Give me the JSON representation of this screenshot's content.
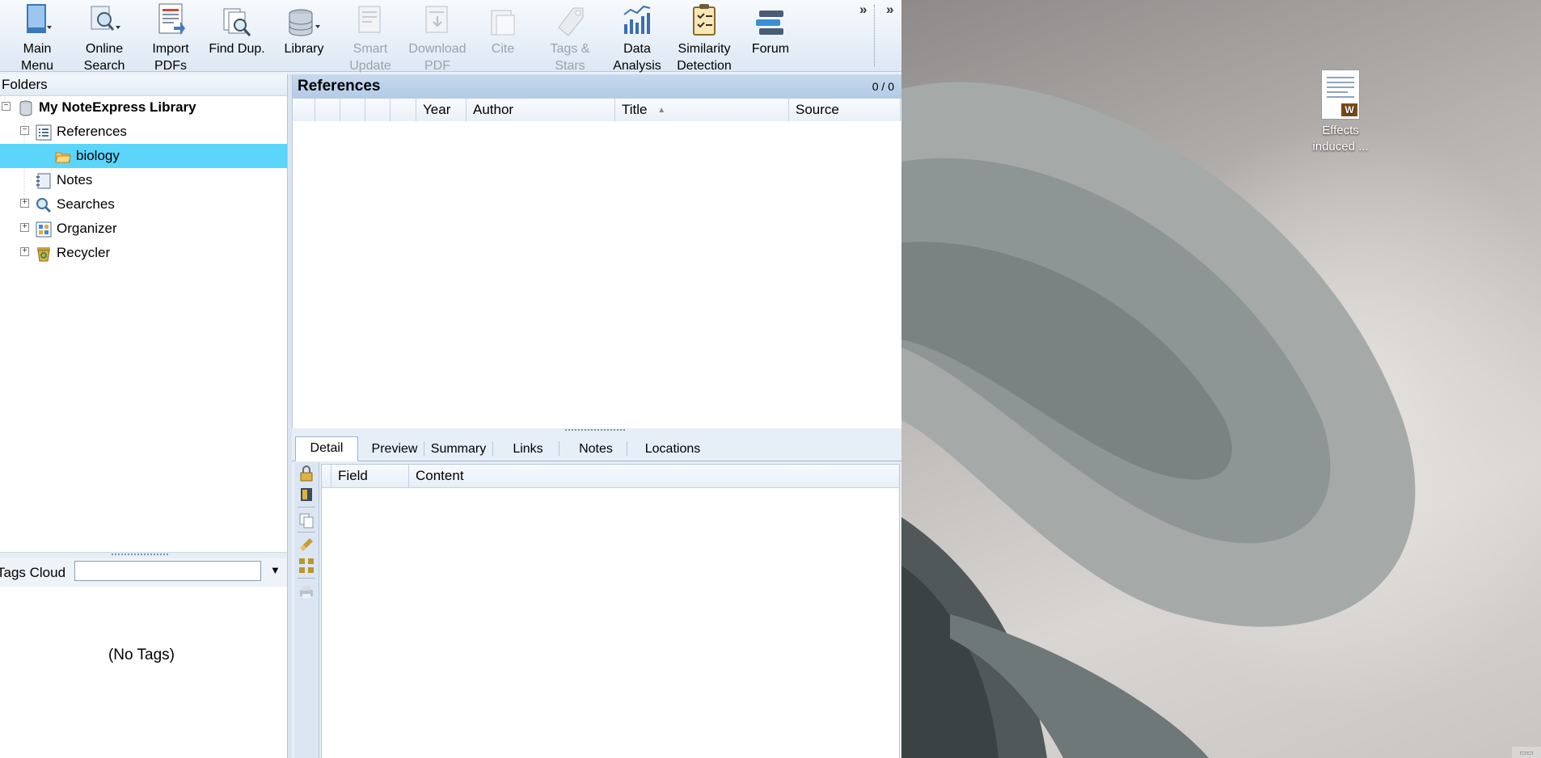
{
  "toolbar": {
    "items": [
      {
        "label_1": "Main",
        "label_2": "Menu",
        "icon": "main-menu-icon",
        "enabled": true
      },
      {
        "label_1": "Online",
        "label_2": "Search",
        "icon": "online-search-icon",
        "enabled": true
      },
      {
        "label_1": "Import",
        "label_2": "PDFs",
        "icon": "import-pdfs-icon",
        "enabled": true
      },
      {
        "label_1": "Find Dup.",
        "label_2": "",
        "icon": "find-duplicates-icon",
        "enabled": true
      },
      {
        "label_1": "Library",
        "label_2": "",
        "icon": "library-icon",
        "enabled": true
      },
      {
        "label_1": "Smart",
        "label_2": "Update",
        "icon": "smart-update-icon",
        "enabled": false
      },
      {
        "label_1": "Download",
        "label_2": "PDF",
        "icon": "download-pdf-icon",
        "enabled": false
      },
      {
        "label_1": "Cite",
        "label_2": "",
        "icon": "cite-icon",
        "enabled": false
      },
      {
        "label_1": "Tags &",
        "label_2": "Stars",
        "icon": "tags-stars-icon",
        "enabled": false
      },
      {
        "label_1": "Data",
        "label_2": "Analysis",
        "icon": "data-analysis-icon",
        "enabled": true
      },
      {
        "label_1": "Similarity",
        "label_2": "Detection",
        "icon": "similarity-detection-icon",
        "enabled": true
      },
      {
        "label_1": "Forum",
        "label_2": "",
        "icon": "forum-icon",
        "enabled": true
      }
    ],
    "overflow": "»"
  },
  "folders": {
    "title": "Folders",
    "root": "My NoteExpress Library",
    "items": [
      "References",
      "biology",
      "Notes",
      "Searches",
      "Organizer",
      "Recycler"
    ],
    "selected": "biology"
  },
  "tags": {
    "label": "Tags Cloud",
    "placeholder": "",
    "empty": "(No Tags)"
  },
  "references": {
    "title": "References",
    "count": "0 / 0",
    "columns": [
      "Year",
      "Author",
      "Title",
      "Source"
    ],
    "sort_indicator": "▲",
    "rows": []
  },
  "detail": {
    "tabs": [
      "Detail",
      "Preview",
      "Summary",
      "Links",
      "Notes",
      "Locations"
    ],
    "active_tab": "Detail",
    "columns": [
      "Field",
      "Content"
    ]
  },
  "desktop": {
    "file_label_1": "Effects",
    "file_label_2": "induced ..."
  },
  "colors": {
    "selection": "#5cd5fb",
    "ribbon": "#dde8f4",
    "header": "#b3cbe6"
  }
}
